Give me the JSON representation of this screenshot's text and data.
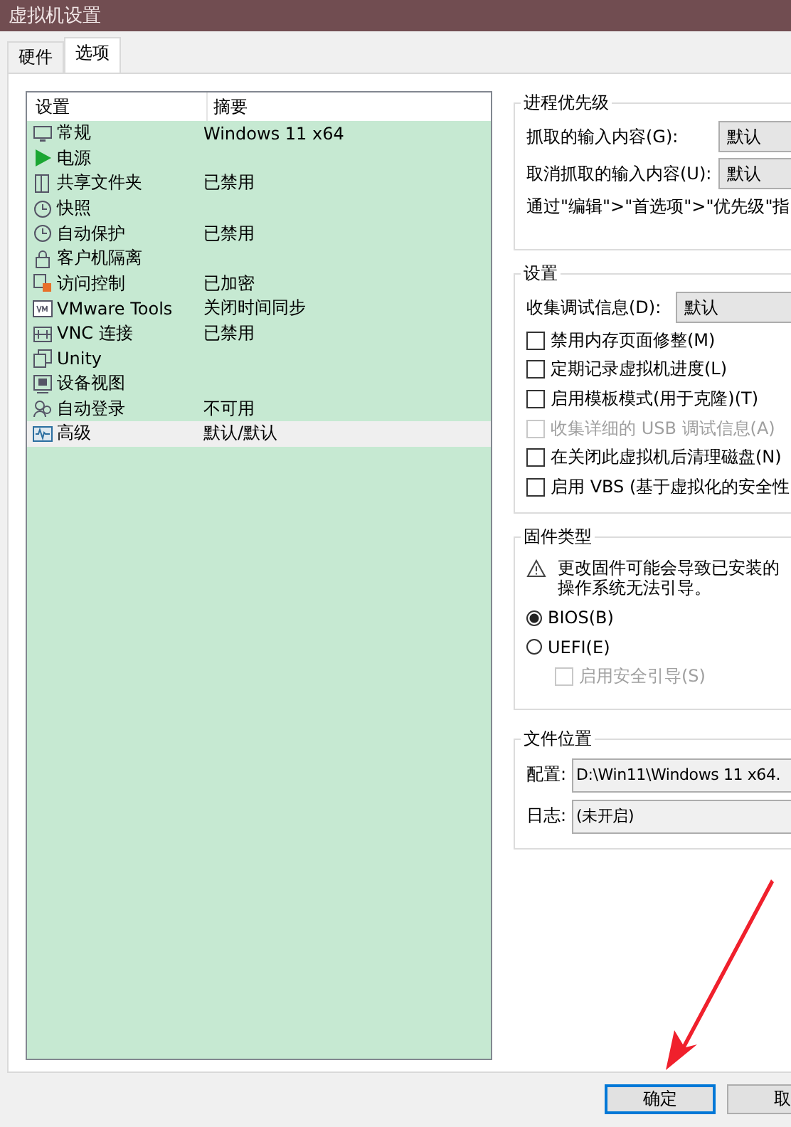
{
  "window": {
    "title": "虚拟机设置"
  },
  "tabs": [
    {
      "label": "硬件",
      "selected": false
    },
    {
      "label": "选项",
      "selected": true
    }
  ],
  "settings_list": {
    "columns": [
      "设置",
      "摘要"
    ],
    "rows": [
      {
        "name": "常规",
        "summary": "Windows 11 x64",
        "selected": false
      },
      {
        "name": "电源",
        "summary": "",
        "selected": false
      },
      {
        "name": "共享文件夹",
        "summary": "已禁用",
        "selected": false
      },
      {
        "name": "快照",
        "summary": "",
        "selected": false
      },
      {
        "name": "自动保护",
        "summary": "已禁用",
        "selected": false
      },
      {
        "name": "客户机隔离",
        "summary": "",
        "selected": false
      },
      {
        "name": "访问控制",
        "summary": "已加密",
        "selected": false
      },
      {
        "name": "VMware Tools",
        "summary": "关闭时间同步",
        "selected": false
      },
      {
        "name": "VNC 连接",
        "summary": "已禁用",
        "selected": false
      },
      {
        "name": "Unity",
        "summary": "",
        "selected": false
      },
      {
        "name": "设备视图",
        "summary": "",
        "selected": false
      },
      {
        "name": "自动登录",
        "summary": "不可用",
        "selected": false
      },
      {
        "name": "高级",
        "summary": "默认/默认",
        "selected": true
      }
    ]
  },
  "process_priority": {
    "title": "进程优先级",
    "fields": [
      {
        "label": "抓取的输入内容(G):",
        "value": "默认"
      },
      {
        "label": "取消抓取的输入内容(U):",
        "value": "默认"
      }
    ],
    "note": "通过\"编辑\">\"首选项\">\"优先级\"指"
  },
  "settings": {
    "title": "设置",
    "field": {
      "label": "收集调试信息(D):",
      "value": "默认"
    },
    "options": [
      {
        "label": "禁用内存页面修整(M)",
        "checked": false,
        "disabled": false
      },
      {
        "label": "定期记录虚拟机进度(L)",
        "checked": false,
        "disabled": false
      },
      {
        "label": "启用模板模式(用于克隆)(T)",
        "checked": false,
        "disabled": false
      },
      {
        "label": "收集详细的 USB 调试信息(A)",
        "checked": false,
        "disabled": true
      },
      {
        "label": "在关闭此虚拟机后清理磁盘(N)",
        "checked": false,
        "disabled": false
      },
      {
        "label": "启用 VBS (基于虚拟化的安全性",
        "checked": false,
        "disabled": false
      }
    ]
  },
  "firmware": {
    "title": "固件类型",
    "warning": [
      "更改固件可能会导致已安装的",
      "操作系统无法引导。"
    ],
    "choices": [
      {
        "label": "BIOS(B)",
        "selected": true
      },
      {
        "label": "UEFI(E)",
        "selected": false
      }
    ],
    "secure_boot": {
      "label": "启用安全引导(S)",
      "checked": false,
      "disabled": true
    }
  },
  "file_location": {
    "title": "文件位置",
    "fields": [
      {
        "label": "配置:",
        "value": "D:\\Win11\\Windows 11 x64."
      },
      {
        "label": "日志:",
        "value": "(未开启)"
      }
    ]
  },
  "buttons": [
    {
      "label": "确定",
      "default": true
    },
    {
      "label": "取",
      "default": false
    }
  ]
}
